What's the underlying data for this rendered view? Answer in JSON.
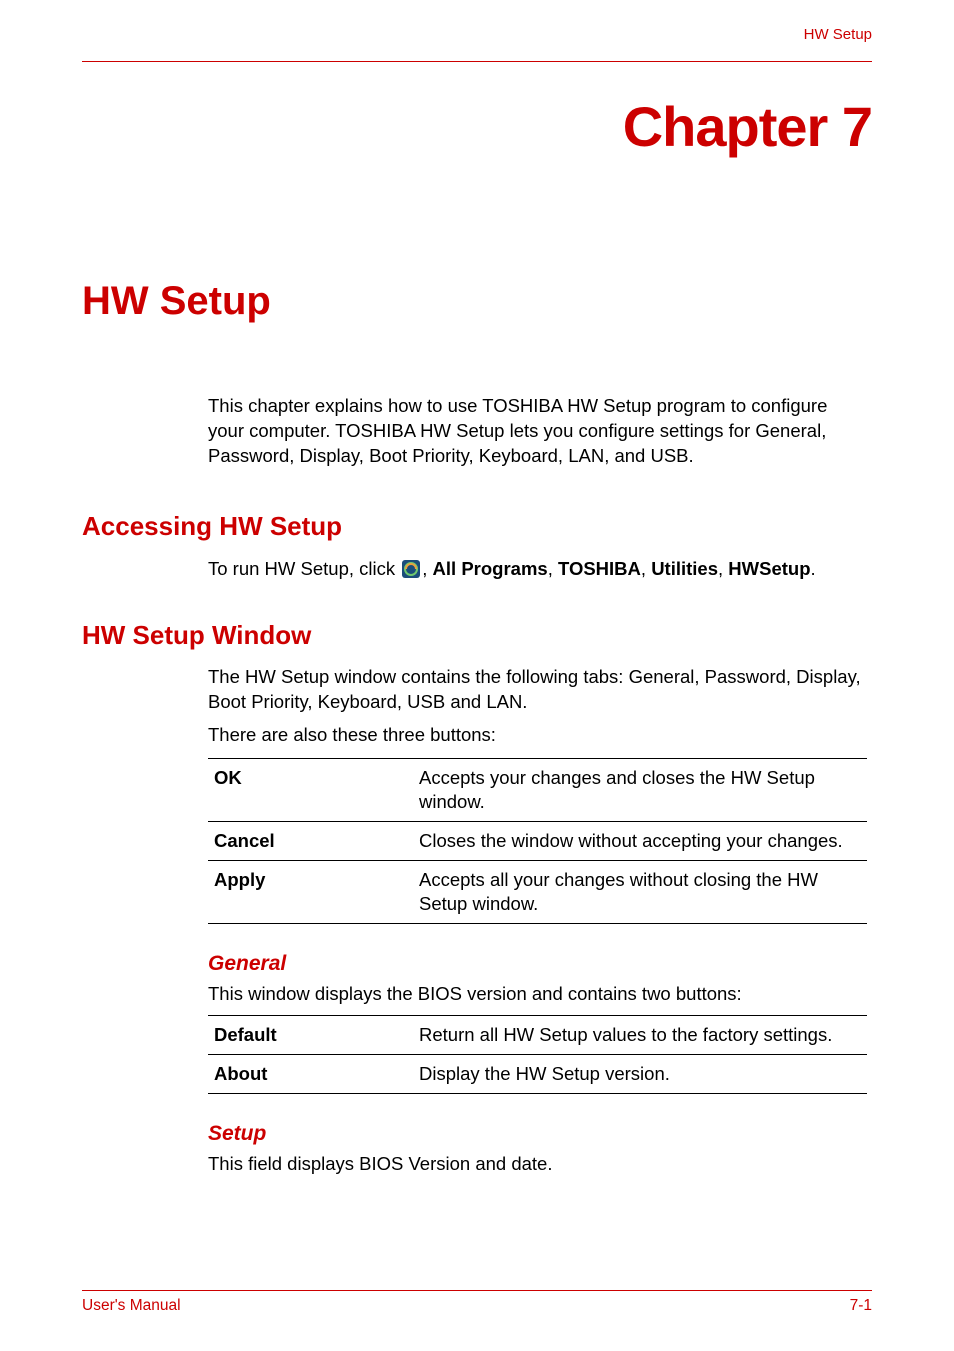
{
  "header": {
    "label": "HW Setup"
  },
  "chapter": {
    "title": "Chapter 7"
  },
  "page": {
    "title": "HW Setup"
  },
  "intro": "This chapter explains how to use TOSHIBA HW Setup program to configure your computer. TOSHIBA HW Setup lets you configure settings for General, Password, Display, Boot Priority, Keyboard, LAN, and USB.",
  "accessing": {
    "heading": "Accessing HW Setup",
    "run_prefix": "To run HW Setup, click ",
    "run_sep": ", ",
    "all_programs": "All Programs",
    "toshiba": "TOSHIBA",
    "utilities": "Utilities",
    "hwsetup": "HWSetup",
    "period": "."
  },
  "window": {
    "heading": "HW Setup Window",
    "desc": "The HW Setup window contains the following tabs: General, Password, Display, Boot Priority, Keyboard, USB and LAN.",
    "buttons_intro": "There are also these three buttons:",
    "buttons": [
      {
        "term": "OK",
        "desc": "Accepts your changes and closes the HW Setup window."
      },
      {
        "term": "Cancel",
        "desc": "Closes the window without accepting your changes."
      },
      {
        "term": "Apply",
        "desc": "Accepts all your changes without closing the HW Setup window."
      }
    ]
  },
  "general": {
    "heading": "General",
    "desc": "This window displays the BIOS version and contains two buttons:",
    "buttons": [
      {
        "term": "Default",
        "desc": "Return all HW Setup values to the factory settings."
      },
      {
        "term": "About",
        "desc": "Display the HW Setup version."
      }
    ]
  },
  "setup": {
    "heading": "Setup",
    "desc": "This field displays BIOS Version and date."
  },
  "footer": {
    "left": "User's Manual",
    "right": "7-1"
  }
}
